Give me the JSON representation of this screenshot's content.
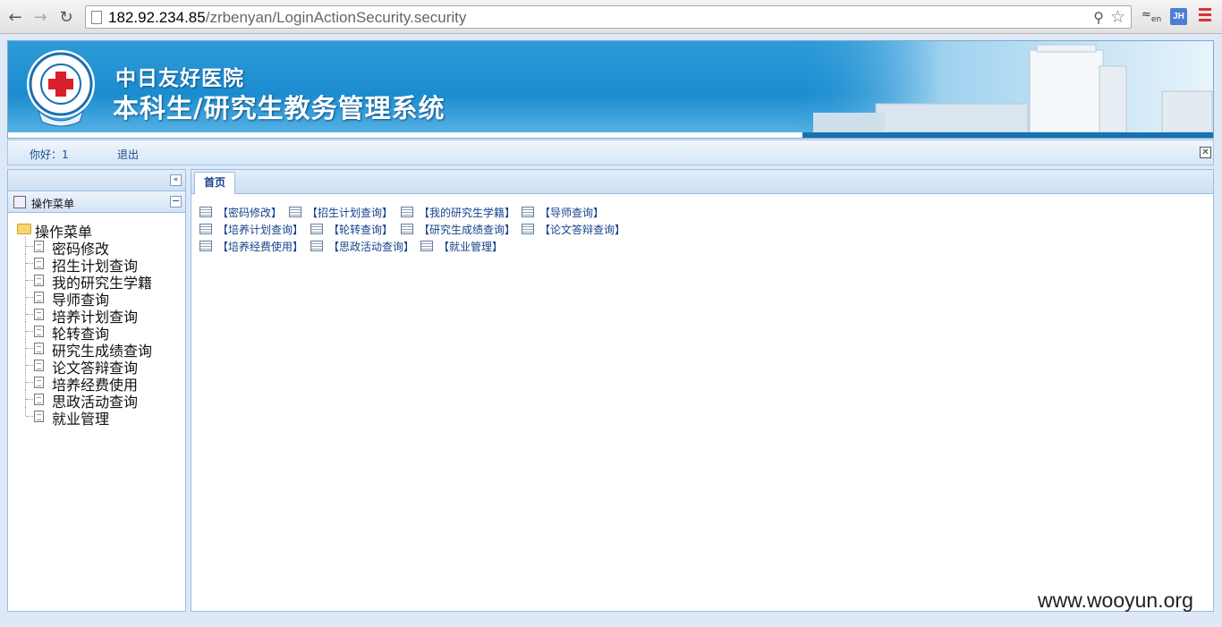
{
  "browser": {
    "url_host": "182.92.234.85",
    "url_path": "/zrbenyan/LoginActionSecurity.security",
    "translate_icon_text": "en",
    "extension_badge": "JH"
  },
  "header": {
    "hospital_name": "中日友好医院",
    "system_name": "本科生/研究生教务管理系统"
  },
  "userbar": {
    "greeting": "你好：1",
    "logout_label": "退出",
    "close_symbol": "✕"
  },
  "sidebar": {
    "panel_title": "操作菜单",
    "tree_root": "操作菜单",
    "items": [
      {
        "label": "密码修改"
      },
      {
        "label": "招生计划查询"
      },
      {
        "label": "我的研究生学籍"
      },
      {
        "label": "导师查询"
      },
      {
        "label": "培养计划查询"
      },
      {
        "label": "轮转查询"
      },
      {
        "label": "研究生成绩查询"
      },
      {
        "label": "论文答辩查询"
      },
      {
        "label": "培养经费使用"
      },
      {
        "label": "思政活动查询"
      },
      {
        "label": "就业管理"
      }
    ]
  },
  "main": {
    "tab_label": "首页",
    "quick_links": [
      {
        "label": "【密码修改】"
      },
      {
        "label": "【招生计划查询】"
      },
      {
        "label": "【我的研究生学籍】"
      },
      {
        "label": "【导师查询】"
      },
      {
        "label": "【培养计划查询】"
      },
      {
        "label": "【轮转查询】"
      },
      {
        "label": "【研究生成绩查询】"
      },
      {
        "label": "【论文答辩查询】"
      },
      {
        "label": "【培养经费使用】"
      },
      {
        "label": "【思政活动查询】"
      },
      {
        "label": "【就业管理】"
      }
    ]
  },
  "watermark": "www.wooyun.org"
}
